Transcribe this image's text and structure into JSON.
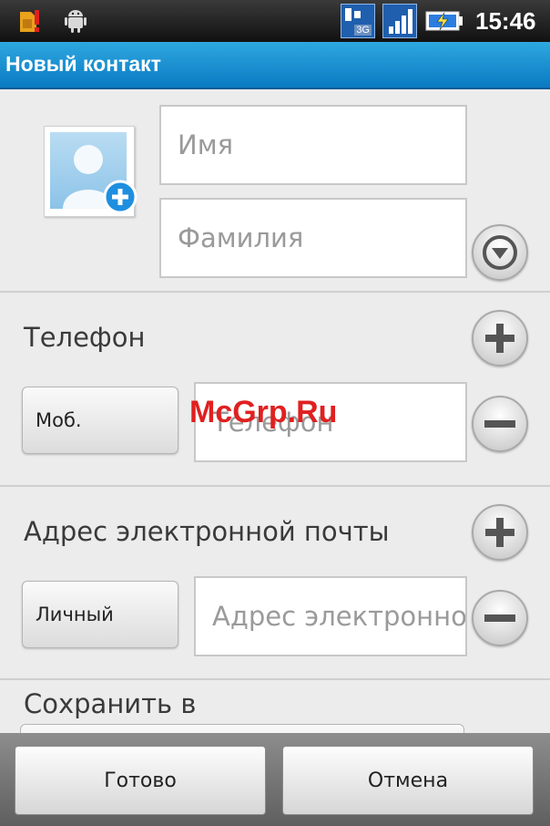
{
  "status_bar": {
    "time": "15:46",
    "network_label": "3G",
    "icons": [
      "sim-alert-icon",
      "android-debug-icon",
      "network-3g-icon",
      "signal-icon",
      "battery-charging-icon"
    ]
  },
  "header": {
    "title": "Новый контакт"
  },
  "name_section": {
    "first_name_placeholder": "Имя",
    "last_name_placeholder": "Фамилия"
  },
  "phone_section": {
    "label": "Телефон",
    "type_label": "Моб.",
    "placeholder": "Телефон"
  },
  "email_section": {
    "label": "Адрес электронной почты",
    "type_label": "Личный",
    "placeholder": "Адрес электронной почты"
  },
  "save_section": {
    "label": "Сохранить в"
  },
  "watermark": "McGrp.Ru",
  "footer": {
    "done_label": "Готово",
    "cancel_label": "Отмена"
  },
  "colors": {
    "title_bar": "#1a8fd0",
    "watermark": "#e02020",
    "avatar_plus": "#1e8fe0"
  }
}
